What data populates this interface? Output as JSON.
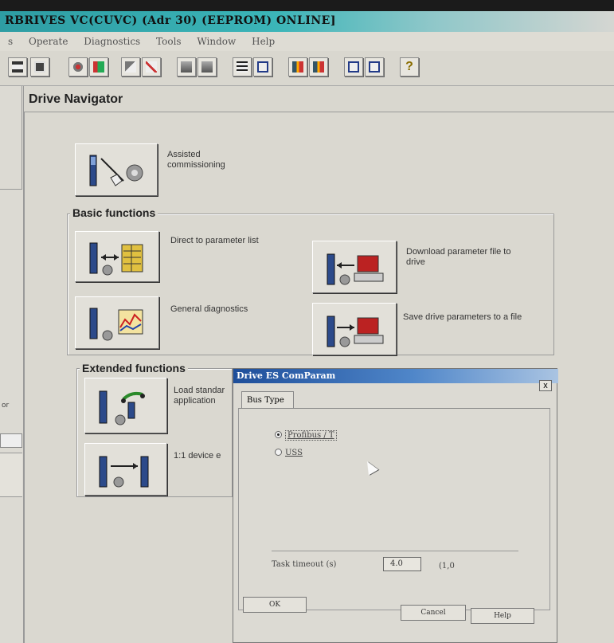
{
  "window": {
    "title": "RBRIVES VC(CUVC)  (Adr   30)   (EEPROM)  ONLINE]"
  },
  "menu": {
    "items": [
      "s",
      "Operate",
      "Diagnostics",
      "Tools",
      "Window",
      "Help"
    ]
  },
  "toolbar": {
    "icons": [
      "network-icon",
      "module-icon",
      "gear-icon",
      "parameter-icon",
      "tool-icon",
      "chart-icon",
      "drive-icon",
      "drive-icon-2",
      "table-icon",
      "window-icon",
      "upload-icon",
      "download-icon",
      "panel-icon",
      "panel-icon-2",
      "help-icon"
    ],
    "help_label": "?"
  },
  "navigator": {
    "title": "Drive Navigator",
    "assisted": {
      "label": "Assisted commissioning"
    },
    "basic_group": {
      "title": "Basic functions",
      "items": [
        {
          "label": "Direct to parameter list"
        },
        {
          "label": "Download parameter file to drive"
        },
        {
          "label": "General diagnostics"
        },
        {
          "label": "Save drive parameters to a file"
        }
      ]
    },
    "extended_group": {
      "title": "Extended functions",
      "items": [
        {
          "label": "Load standar application"
        },
        {
          "label": "1:1 device e"
        }
      ]
    }
  },
  "left_panel": {
    "label": "or"
  },
  "dialog": {
    "title": "Drive ES ComParam",
    "close_label": "x",
    "tab_label": "Bus Type",
    "options": [
      {
        "label": "Profibus / T",
        "selected": true
      },
      {
        "label": "USS",
        "selected": false
      }
    ],
    "timeout_label": "Task timeout (s)",
    "timeout_value": "4.0",
    "timeout_range": "(1,0",
    "ok_label": "OK",
    "cancel_label": "Cancel",
    "help_label": "Help"
  }
}
